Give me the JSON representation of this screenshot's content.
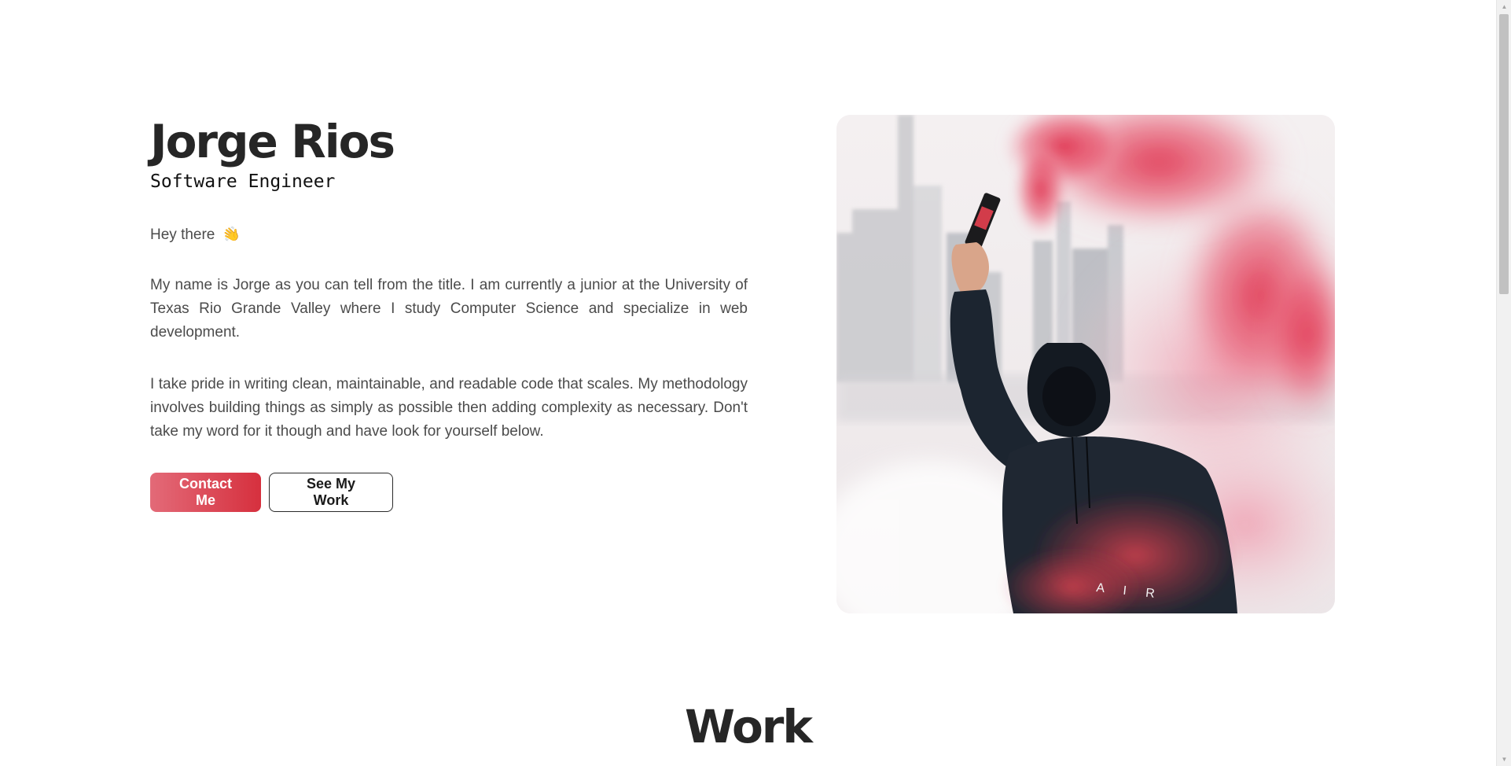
{
  "hero": {
    "name": "Jorge Rios",
    "role": "Software Engineer",
    "greeting": "Hey there",
    "greeting_emoji": "👋",
    "paragraphs": [
      "My name is Jorge as you can tell from the title. I am currently a junior at the University of Texas Rio Grande Valley where I study Computer Science and specialize in web development.",
      "I take pride in writing clean, maintainable, and readable code that scales. My methodology involves building things as simply as possible then adding complexity as necessary. Don't take my word for it though and have look for yourself below."
    ],
    "buttons": {
      "contact_label": "Contact Me",
      "work_label": "See My Work"
    },
    "photo_text": "A I R"
  },
  "work": {
    "title": "Work"
  },
  "colors": {
    "accent_start": "#e36a78",
    "accent_end": "#d6303e",
    "text_dark": "#262626",
    "text_body": "#4b4b4b",
    "smoke": "#e0334f"
  },
  "icons": {
    "scroll_up": "scroll-up-arrow-icon",
    "scroll_down": "scroll-down-arrow-icon"
  }
}
